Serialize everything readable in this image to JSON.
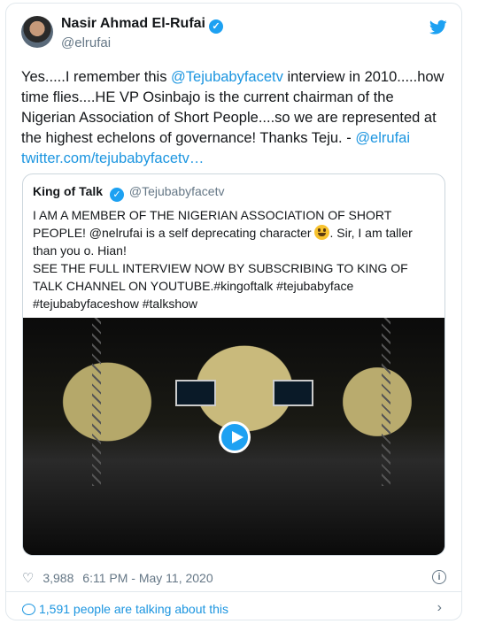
{
  "author": {
    "name": "Nasir Ahmad El-Rufai",
    "handle": "@elrufai"
  },
  "tweet": {
    "p1": "Yes.....I remember this ",
    "mention1": "@Tejubabyfacetv",
    "p2": " interview in 2010.....how time flies....HE VP Osinbajo is the current chairman of the Nigerian Association of Short People....so we are represented at the highest echelons of governance! Thanks Teju. - ",
    "mention2": "@elrufai",
    "link": "twitter.com/tejubabyfacetv…"
  },
  "quoted": {
    "name": "King of Talk",
    "handle": "@Tejubabyfacetv",
    "text1": "I AM A MEMBER OF THE NIGERIAN ASSOCIATION OF SHORT PEOPLE! @nelrufai is a self deprecating character ",
    "text2": ". Sir, I am taller than you o. Hian!",
    "text3": "SEE THE FULL INTERVIEW NOW BY SUBSCRIBING TO KING OF TALK CHANNEL ON YOUTUBE.#kingoftalk #tejubabyface #tejubabyfaceshow #talkshow"
  },
  "meta": {
    "likes": "3,988",
    "time": "6:11 PM - May 11, 2020"
  },
  "footer": {
    "talking": "1,591 people are talking about this"
  },
  "icons": {
    "verified": "verified-badge-icon",
    "bird": "twitter-bird-icon",
    "heart": "heart-icon",
    "info": "info-icon",
    "bubble": "comment-bubble-icon",
    "chevron": "chevron-right-icon"
  },
  "colors": {
    "accent": "#1da1f2",
    "link": "#1b95e0",
    "muted": "#657786"
  }
}
